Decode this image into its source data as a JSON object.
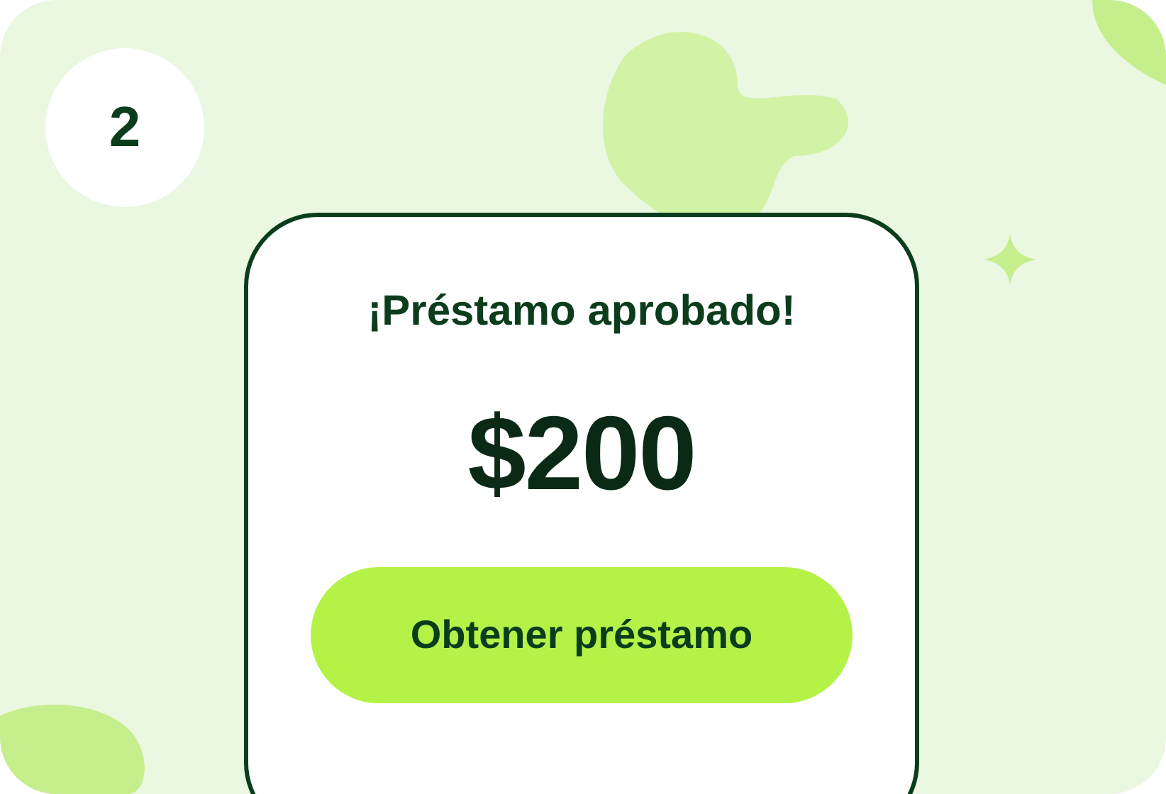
{
  "step_badge": "2",
  "phone": {
    "title": "¡Préstamo aprobado!",
    "amount": "$200",
    "button": "Obtener préstamo"
  }
}
